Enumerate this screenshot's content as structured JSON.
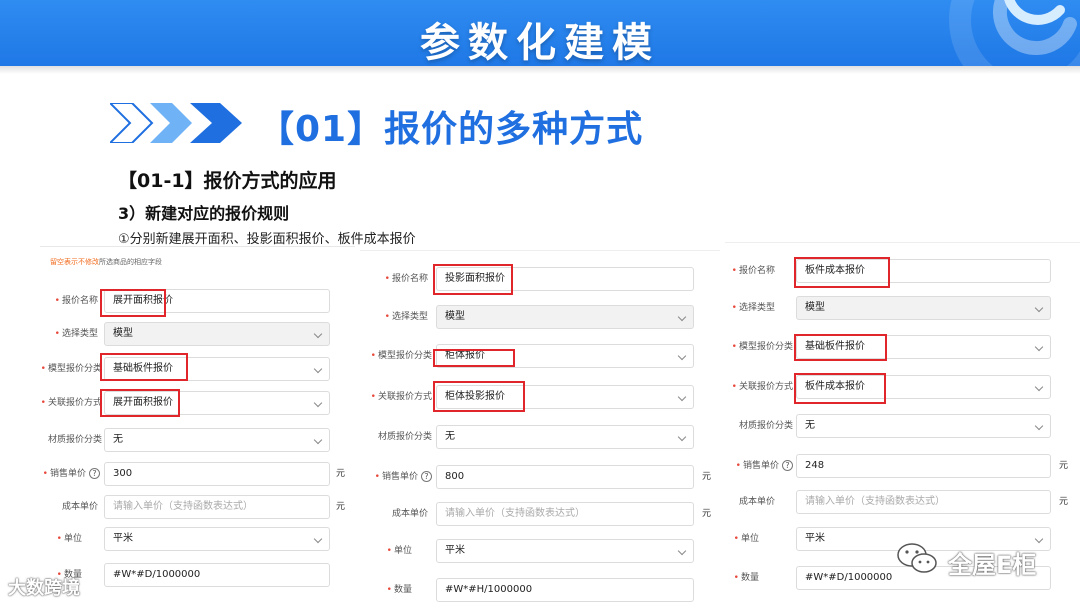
{
  "banner": {
    "title": "参数化建模"
  },
  "section": {
    "title": "【01】报价的多种方式"
  },
  "sub1": "【01-1】报价方式的应用",
  "sub2": "3）新建对应的报价规则",
  "sub3": "①分别新建展开面积、投影面积报价、板件成本报价",
  "panel_a": {
    "hint_warn": "留空表示不修改",
    "hint_rest": "所选商品的相应字段",
    "name_label": "报价名称",
    "name_value": "展开面积报价",
    "type_label": "选择类型",
    "type_value": "模型",
    "model_cat_label": "模型报价分类",
    "model_cat_value": "基础板件报价",
    "method_label": "关联报价方式",
    "method_value": "展开面积报价",
    "material_label": "材质报价分类",
    "material_value": "无",
    "price_label": "销售单价",
    "price_value": "300",
    "price_unit": "元",
    "cost_label": "成本单价",
    "cost_placeholder": "请输入单价（支持函数表达式）",
    "cost_unit": "元",
    "unit_label": "单位",
    "unit_value": "平米",
    "qty_label": "数量",
    "qty_value": "#W*#D/1000000"
  },
  "panel_b": {
    "name_label": "报价名称",
    "name_value": "投影面积报价",
    "type_label": "选择类型",
    "type_value": "模型",
    "model_cat_label": "模型报价分类",
    "model_cat_value": "柜体报价",
    "method_label": "关联报价方式",
    "method_value": "柜体投影报价",
    "material_label": "材质报价分类",
    "material_value": "无",
    "price_label": "销售单价",
    "price_value": "800",
    "price_unit": "元",
    "cost_label": "成本单价",
    "cost_placeholder": "请输入单价（支持函数表达式）",
    "cost_unit": "元",
    "unit_label": "单位",
    "unit_value": "平米",
    "qty_label": "数量",
    "qty_value": "#W*#H/1000000"
  },
  "panel_c": {
    "name_label": "报价名称",
    "name_value": "板件成本报价",
    "type_label": "选择类型",
    "type_value": "模型",
    "model_cat_label": "模型报价分类",
    "model_cat_value": "基础板件报价",
    "method_label": "关联报价方式",
    "method_value": "板件成本报价",
    "material_label": "材质报价分类",
    "material_value": "无",
    "price_label": "销售单价",
    "price_value": "248",
    "price_unit": "元",
    "cost_label": "成本单价",
    "cost_placeholder": "请输入单价（支持函数表达式）",
    "cost_unit": "元",
    "unit_label": "单位",
    "unit_value": "平米",
    "qty_label": "数量",
    "qty_value": "#W*#D/1000000"
  },
  "watermark_left": "大数跨境",
  "watermark_right": "全屋E柜",
  "colors": {
    "banner": "#2f8cf1",
    "title": "#1f6fe0",
    "highlight": "#e0262b",
    "warn": "#f26b1d"
  }
}
